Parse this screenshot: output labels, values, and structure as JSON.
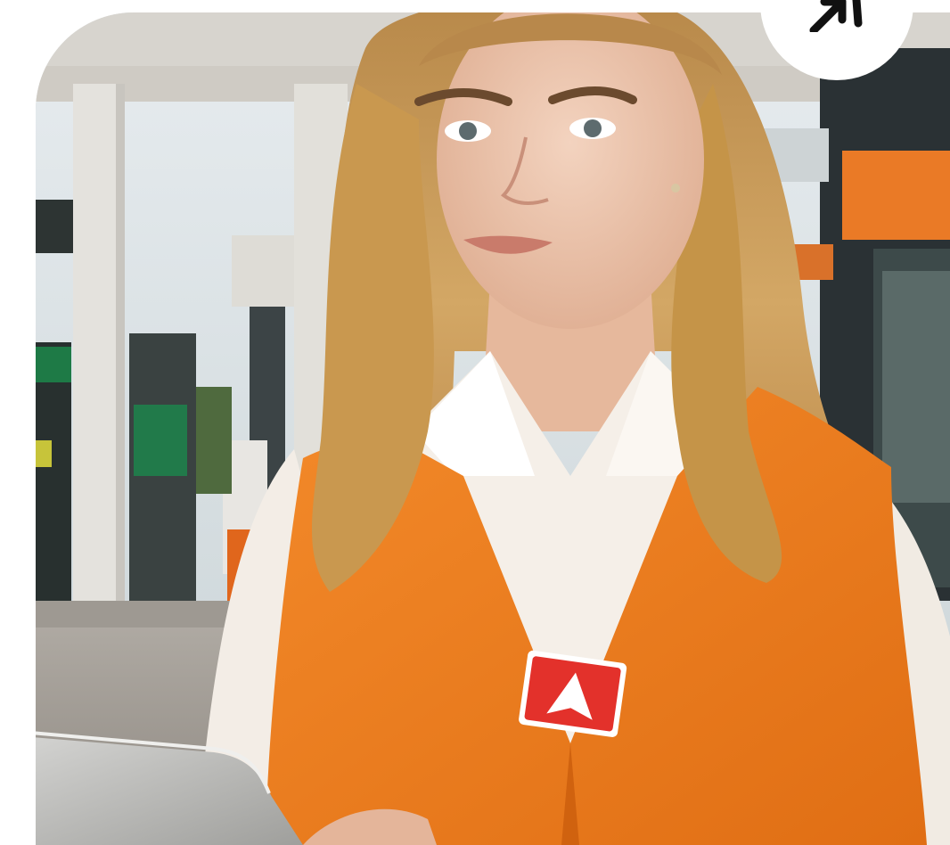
{
  "photo": {
    "subject": "gas-station-attendant-photo",
    "colors": {
      "vest": "#f07d1e",
      "shirt": "#f4eee8",
      "hair": "#c99a55",
      "badge": "#e3312b",
      "canopy": "#d9d7d2",
      "accent_orange": "#ea7a26"
    }
  },
  "corner_action": {
    "icon": "arrow-up-right-icon"
  }
}
